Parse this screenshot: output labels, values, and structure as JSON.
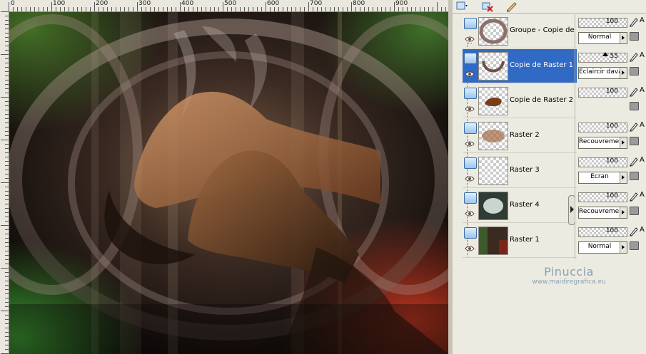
{
  "ruler": {
    "labels": [
      "0",
      "100",
      "200",
      "300",
      "400",
      "500",
      "600",
      "700",
      "800",
      "900"
    ]
  },
  "layers": [
    {
      "name": "Groupe - Copie de R",
      "opacity": "100",
      "blend": "Normal",
      "selected": false,
      "thumb": "frame"
    },
    {
      "name": "Copie de Raster 1",
      "opacity": "55",
      "blend": "Éclaircir davantage",
      "selected": true,
      "thumb": "arc"
    },
    {
      "name": "Copie de Raster 2",
      "opacity": "100",
      "blend": "",
      "selected": false,
      "thumb": "figure"
    },
    {
      "name": "Raster 2",
      "opacity": "100",
      "blend": "Recouvrement",
      "selected": false,
      "thumb": "blur"
    },
    {
      "name": "Raster 3",
      "opacity": "100",
      "blend": "Écran",
      "selected": false,
      "thumb": "empty"
    },
    {
      "name": "Raster 4",
      "opacity": "100",
      "blend": "Recouvrement",
      "selected": false,
      "thumb": "cloud"
    },
    {
      "name": "Raster 1",
      "opacity": "100",
      "blend": "Normal",
      "selected": false,
      "thumb": "dark"
    }
  ],
  "props": {
    "a_label": "A"
  },
  "watermark": {
    "title": "Pinuccia",
    "url": "www.maidiregrafica.eu"
  },
  "colors": {
    "selection": "#316ac5",
    "panel_bg": "#ecebe2",
    "watermark": "#8aa0b2"
  }
}
